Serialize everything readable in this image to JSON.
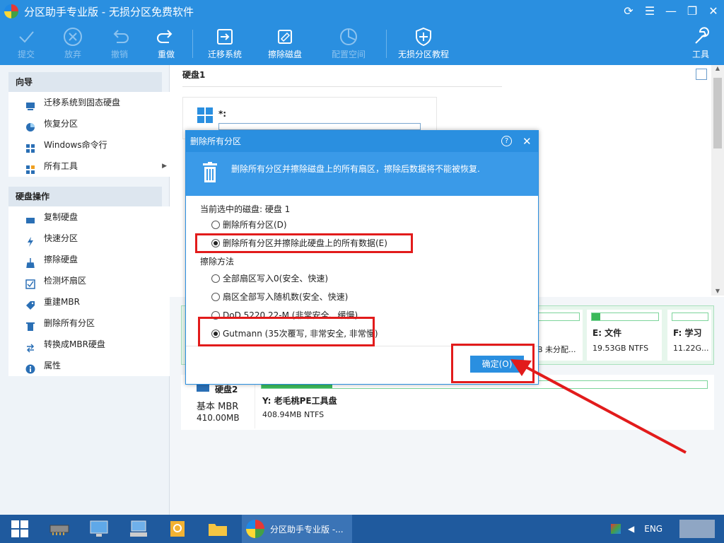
{
  "window": {
    "title": "分区助手专业版 - 无损分区免费软件"
  },
  "toolbar": {
    "commit": "提交",
    "discard": "放弃",
    "undo": "撤销",
    "redo": "重做",
    "migrate": "迁移系统",
    "wipe": "擦除磁盘",
    "alloc": "配置空间",
    "tutorial": "无损分区教程",
    "tools": "工具"
  },
  "sidebar": {
    "wizard_title": "向导",
    "wizard_items": [
      "迁移系统到固态硬盘",
      "恢复分区",
      "Windows命令行",
      "所有工具"
    ],
    "disk_ops_title": "硬盘操作",
    "disk_ops_items": [
      "复制硬盘",
      "快速分区",
      "擦除硬盘",
      "检测坏扇区",
      "重建MBR",
      "删除所有分区",
      "转换成MBR硬盘",
      "属性"
    ]
  },
  "main": {
    "disk1_header": "硬盘1",
    "disk1_drive": "*:",
    "partitions": [
      {
        "name": "E: 文件",
        "size": "19.53GB NTFS"
      },
      {
        "name": "F: 学习",
        "size": "11.22G..."
      }
    ],
    "unalloc_partial": "B 未分配...",
    "disk2": {
      "name": "硬盘2",
      "type": "基本 MBR",
      "size": "410.00MB",
      "part_name": "Y: 老毛桃PE工具盘",
      "part_size": "408.94MB NTFS"
    }
  },
  "dialog": {
    "title": "删除所有分区",
    "banner": "删除所有分区并擦除磁盘上的所有扇区，擦除后数据将不能被恢复.",
    "current_disk": "当前选中的磁盘: 硬盘 1",
    "opt_delete": "删除所有分区(D)",
    "opt_delete_wipe": "删除所有分区并擦除此硬盘上的所有数据(E)",
    "wipe_method": "擦除方法",
    "m1": "全部扇区写入0(安全、快速)",
    "m2": "扇区全部写入随机数(安全、快速)",
    "m3": "DoD 5220.22-M (非常安全、缓慢)",
    "m4": "Gutmann (35次覆写, 非常安全, 非常慢)",
    "ok": "确定(O)"
  },
  "taskbar": {
    "app": "分区助手专业版 -...",
    "lang": "ENG"
  },
  "colors": {
    "accent": "#2a8fe0",
    "highlight": "#e21b1b"
  }
}
